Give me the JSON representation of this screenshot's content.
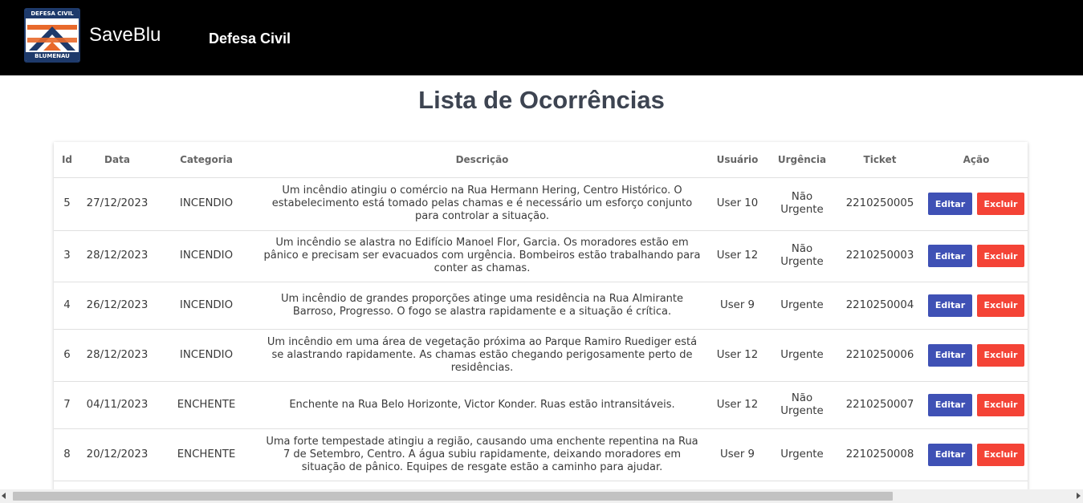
{
  "header": {
    "logo_top_text": "DEFESA CIVIL",
    "logo_bottom_text": "BLUMENAU",
    "brand": "SaveBlu",
    "nav_link": "Defesa Civil"
  },
  "page_title": "Lista de Ocorrências",
  "table": {
    "columns": [
      "Id",
      "Data",
      "Categoria",
      "Descrição",
      "Usuário",
      "Urgência",
      "Ticket",
      "Ação"
    ],
    "edit_label": "Editar",
    "delete_label": "Excluir",
    "rows": [
      {
        "id": "5",
        "data": "27/12/2023",
        "categoria": "INCENDIO",
        "descricao": "Um incêndio atingiu o comércio na Rua Hermann Hering, Centro Histórico. O estabelecimento está tomado pelas chamas e é necessário um esforço conjunto para controlar a situação.",
        "usuario": "User 10",
        "urgencia": "Não Urgente",
        "ticket": "2210250005"
      },
      {
        "id": "3",
        "data": "28/12/2023",
        "categoria": "INCENDIO",
        "descricao": "Um incêndio se alastra no Edifício Manoel Flor, Garcia. Os moradores estão em pânico e precisam ser evacuados com urgência. Bombeiros estão trabalhando para conter as chamas.",
        "usuario": "User 12",
        "urgencia": "Não Urgente",
        "ticket": "2210250003"
      },
      {
        "id": "4",
        "data": "26/12/2023",
        "categoria": "INCENDIO",
        "descricao": "Um incêndio de grandes proporções atinge uma residência na Rua Almirante Barroso, Progresso. O fogo se alastra rapidamente e a situação é crítica.",
        "usuario": "User 9",
        "urgencia": "Urgente",
        "ticket": "2210250004"
      },
      {
        "id": "6",
        "data": "28/12/2023",
        "categoria": "INCENDIO",
        "descricao": "Um incêndio em uma área de vegetação próxima ao Parque Ramiro Ruediger está se alastrando rapidamente. As chamas estão chegando perigosamente perto de residências.",
        "usuario": "User 12",
        "urgencia": "Urgente",
        "ticket": "2210250006"
      },
      {
        "id": "7",
        "data": "04/11/2023",
        "categoria": "ENCHENTE",
        "descricao": "Enchente na Rua Belo Horizonte, Victor Konder. Ruas estão intransitáveis.",
        "usuario": "User 12",
        "urgencia": "Não Urgente",
        "ticket": "2210250007"
      },
      {
        "id": "8",
        "data": "20/12/2023",
        "categoria": "ENCHENTE",
        "descricao": "Uma forte tempestade atingiu a região, causando uma enchente repentina na Rua 7 de Setembro, Centro. A água subiu rapidamente, deixando moradores em situação de pânico. Equipes de resgate estão a caminho para ajudar.",
        "usuario": "User 9",
        "urgencia": "Urgente",
        "ticket": "2210250008"
      }
    ]
  },
  "colors": {
    "header_bg": "#000000",
    "edit_button": "#3f51b5",
    "delete_button": "#f44336",
    "title": "#3d4451"
  }
}
